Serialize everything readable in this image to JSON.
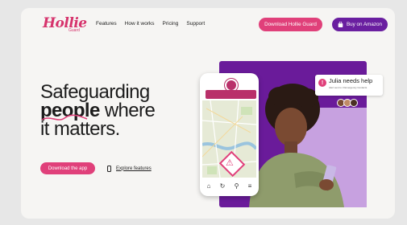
{
  "brand": {
    "name": "Hollie",
    "sub": "Guard"
  },
  "nav": {
    "links": [
      "Features",
      "How it works",
      "Pricing",
      "Support"
    ]
  },
  "header": {
    "download_label": "Download Hollie Guard",
    "amazon_label": "Buy on Amazon"
  },
  "hero": {
    "line1": "Safeguarding",
    "line2_highlight": "people",
    "line2_rest": " where",
    "line3": "it matters.",
    "cta_label": "Download the app",
    "explore_label": "Explore features"
  },
  "notification": {
    "title": "Julia needs help",
    "sub": "Alert sent to 3 Emergency Contacts"
  },
  "colors": {
    "accent": "#e0407a",
    "brand_purple": "#6a1fa0",
    "lavender": "#c7a1e0"
  }
}
